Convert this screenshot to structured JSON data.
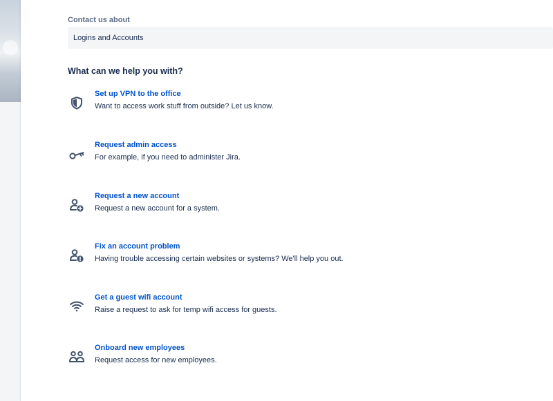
{
  "contact": {
    "label": "Contact us about",
    "selected_value": "Logins and Accounts"
  },
  "help_heading": "What can we help you with?",
  "request_types": [
    {
      "title": "Set up VPN to the office",
      "description": "Want to access work stuff from outside? Let us know.",
      "icon": "shield-icon"
    },
    {
      "title": "Request admin access",
      "description": "For example, if you need to administer Jira.",
      "icon": "key-icon"
    },
    {
      "title": "Request a new account",
      "description": "Request a new account for a system.",
      "icon": "add-user-icon"
    },
    {
      "title": "Fix an account problem",
      "description": "Having trouble accessing certain websites or systems? We'll help you out.",
      "icon": "user-warning-icon"
    },
    {
      "title": "Get a guest wifi account",
      "description": "Raise a request to ask for temp wifi access for guests.",
      "icon": "wifi-icon"
    },
    {
      "title": "Onboard new employees",
      "description": "Request access for new employees.",
      "icon": "people-icon"
    }
  ],
  "colors": {
    "link": "#0052cc",
    "text": "#172b4d",
    "label": "#5e6c84",
    "field_background": "#f4f5f7",
    "icon": "#42526e"
  }
}
